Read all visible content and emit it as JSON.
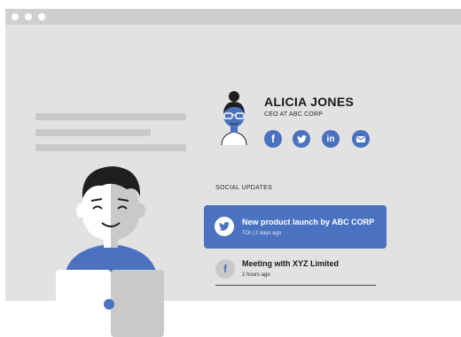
{
  "profile": {
    "name": "ALICIA JONES",
    "title": "CEO AT ABC CORP",
    "social_links": [
      {
        "icon": "facebook-icon",
        "glyph": "f"
      },
      {
        "icon": "twitter-icon",
        "glyph": ""
      },
      {
        "icon": "linkedin-icon",
        "glyph": "in"
      },
      {
        "icon": "mail-icon",
        "glyph": ""
      }
    ]
  },
  "updates": {
    "section_label": "SOCIAL UPDATES",
    "items": [
      {
        "source_icon": "twitter-icon",
        "title": "New product launch by ABC CORP",
        "meta": "TOI | 2 days ago",
        "active": true
      },
      {
        "source_icon": "facebook-icon",
        "title": "Meeting with XYZ Limited",
        "meta": "2 hours ago",
        "active": false
      }
    ]
  },
  "colors": {
    "accent": "#4a72c0",
    "window_bg": "#e2e2e2",
    "titlebar": "#cfcfcf",
    "placeholder_bar": "#c9c9c9"
  }
}
